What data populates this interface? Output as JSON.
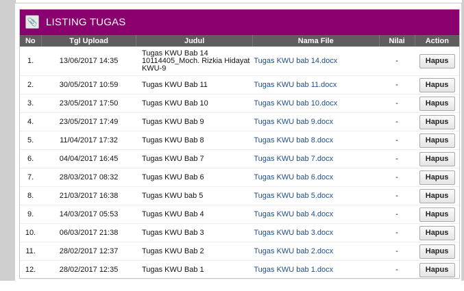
{
  "panel": {
    "title": "LISTING TUGAS",
    "icon": "paperclip-icon"
  },
  "table": {
    "headers": [
      "No",
      "Tgl Upload",
      "Judul",
      "Nama File",
      "Nilai",
      "Action"
    ],
    "rows": [
      {
        "no": "1.",
        "tgl": "13/06/2017 14:35",
        "judul": "Tugas KWU Bab 14 10114405_Moch. Rizkia Hidayat KWU-9",
        "file": "Tugas KWU bab 14.docx",
        "nilai": "-",
        "action": "Hapus"
      },
      {
        "no": "2.",
        "tgl": "30/05/2017 10:59",
        "judul": "Tugas KWU Bab 11",
        "file": "Tugas KWU bab 11.docx",
        "nilai": "-",
        "action": "Hapus"
      },
      {
        "no": "3.",
        "tgl": "23/05/2017 17:50",
        "judul": "Tugas KWU Bab 10",
        "file": "Tugas KWU bab 10.docx",
        "nilai": "-",
        "action": "Hapus"
      },
      {
        "no": "4.",
        "tgl": "23/05/2017 17:49",
        "judul": "Tugas KWU Bab 9",
        "file": "Tugas KWU bab 9.docx",
        "nilai": "-",
        "action": "Hapus"
      },
      {
        "no": "5.",
        "tgl": "11/04/2017 17:32",
        "judul": "Tugas KWU Bab 8",
        "file": "Tugas KWU bab 8.docx",
        "nilai": "-",
        "action": "Hapus"
      },
      {
        "no": "6.",
        "tgl": "04/04/2017 16:45",
        "judul": "Tugas KWU Bab 7",
        "file": "Tugas KWU bab 7.docx",
        "nilai": "-",
        "action": "Hapus"
      },
      {
        "no": "7.",
        "tgl": "28/03/2017 08:32",
        "judul": "Tugas KWU Bab 6",
        "file": "Tugas KWU bab 6.docx",
        "nilai": "-",
        "action": "Hapus"
      },
      {
        "no": "8.",
        "tgl": "21/03/2017 16:38",
        "judul": "Tugas KWU bab 5",
        "file": "Tugas KWU bab 5.docx",
        "nilai": "-",
        "action": "Hapus"
      },
      {
        "no": "9.",
        "tgl": "14/03/2017 05:53",
        "judul": "Tugas KWU Bab 4",
        "file": "Tugas KWU bab 4.docx",
        "nilai": "-",
        "action": "Hapus"
      },
      {
        "no": "10.",
        "tgl": "06/03/2017 21:38",
        "judul": "Tugas KWU Bab 3",
        "file": "Tugas KWU bab 3.docx",
        "nilai": "-",
        "action": "Hapus"
      },
      {
        "no": "11.",
        "tgl": "28/02/2017 12:37",
        "judul": "Tugas KWU Bab 2",
        "file": "Tugas KWU bab 2.docx",
        "nilai": "-",
        "action": "Hapus"
      },
      {
        "no": "12.",
        "tgl": "28/02/2017 12:35",
        "judul": "Tugas KWU Bab 1",
        "file": "Tugas KWU bab 1.docx",
        "nilai": "-",
        "action": "Hapus"
      }
    ]
  },
  "colors": {
    "header_bg": "#8a006e",
    "table_head_bg": "#5e5e5e",
    "link": "#1e4c8a"
  }
}
